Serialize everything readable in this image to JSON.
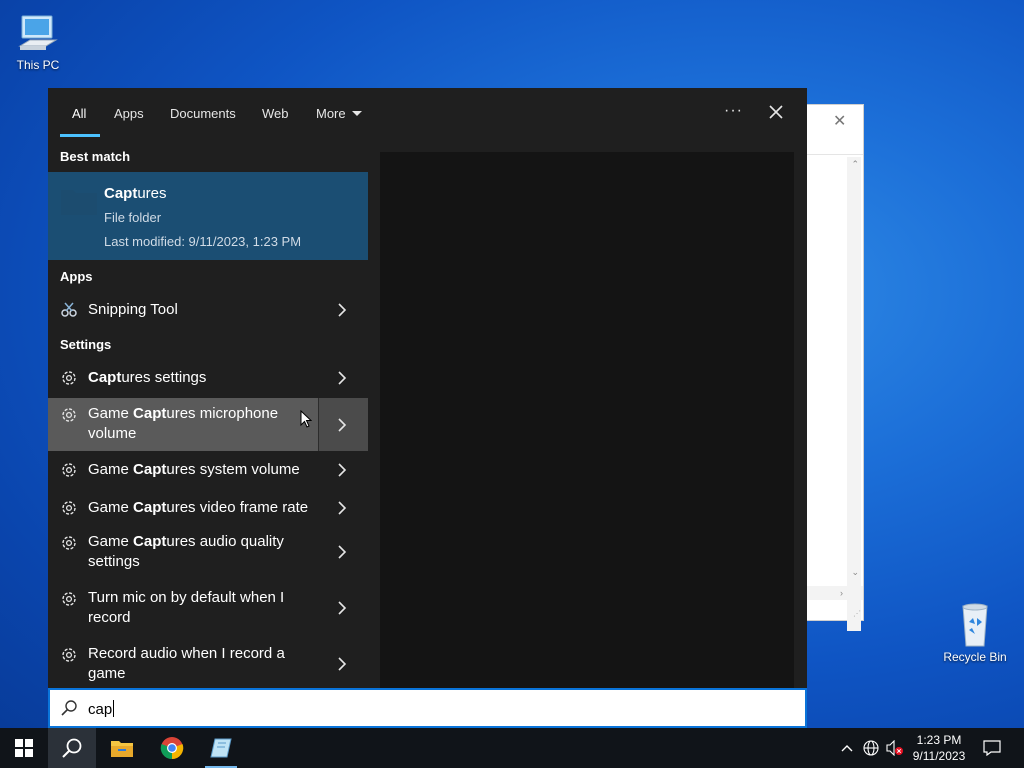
{
  "desktop": {
    "icons": [
      {
        "label": "This PC"
      },
      {
        "label": "Recycle Bin"
      }
    ]
  },
  "background_window": {
    "close_glyph": "✕"
  },
  "search": {
    "tabs": [
      {
        "label": "All",
        "active": true
      },
      {
        "label": "Apps"
      },
      {
        "label": "Documents"
      },
      {
        "label": "Web"
      },
      {
        "label": "More"
      }
    ],
    "ellipsis": "···",
    "sections": {
      "best_match": "Best match",
      "apps": "Apps",
      "settings": "Settings"
    },
    "best_match": {
      "title_bold": "Capt",
      "title_rest": "ures",
      "subtitle": "File folder",
      "modified": "Last modified: 9/11/2023, 1:23 PM",
      "icon": "folder-icon"
    },
    "apps": [
      {
        "pre": "",
        "bold": "",
        "post": "Snipping Tool",
        "icon": "snipping-tool-icon"
      }
    ],
    "settings": [
      {
        "pre": "",
        "bold": "Capt",
        "post": "ures settings",
        "icon": "gear-icon"
      },
      {
        "pre": "Game ",
        "bold": "Capt",
        "post": "ures microphone volume",
        "icon": "gear-icon",
        "hover": true
      },
      {
        "pre": "Game ",
        "bold": "Capt",
        "post": "ures system volume",
        "icon": "gear-icon"
      },
      {
        "pre": "Game ",
        "bold": "Capt",
        "post": "ures video frame rate",
        "icon": "gear-icon"
      },
      {
        "pre": "Game ",
        "bold": "Capt",
        "post": "ures audio quality settings",
        "icon": "gear-icon"
      },
      {
        "pre": "Turn mic on by default when I record",
        "bold": "",
        "post": "",
        "icon": "gear-icon"
      },
      {
        "pre": "Record audio when I record a game",
        "bold": "",
        "post": "",
        "icon": "gear-icon"
      }
    ],
    "query": "cap"
  },
  "taskbar": {
    "apps": [
      "start-icon",
      "search-icon",
      "file-explorer-icon",
      "chrome-icon",
      "snipping-tool-icon"
    ],
    "tray": [
      "chevron-up-icon",
      "network-icon",
      "volume-muted-icon"
    ],
    "time": "1:23 PM",
    "date": "9/11/2023",
    "notification": "notification-icon"
  },
  "colors": {
    "accent": "#4cc2ff",
    "best_match_bg": "#1b4e73",
    "panel_bg": "#1f1f1f"
  }
}
